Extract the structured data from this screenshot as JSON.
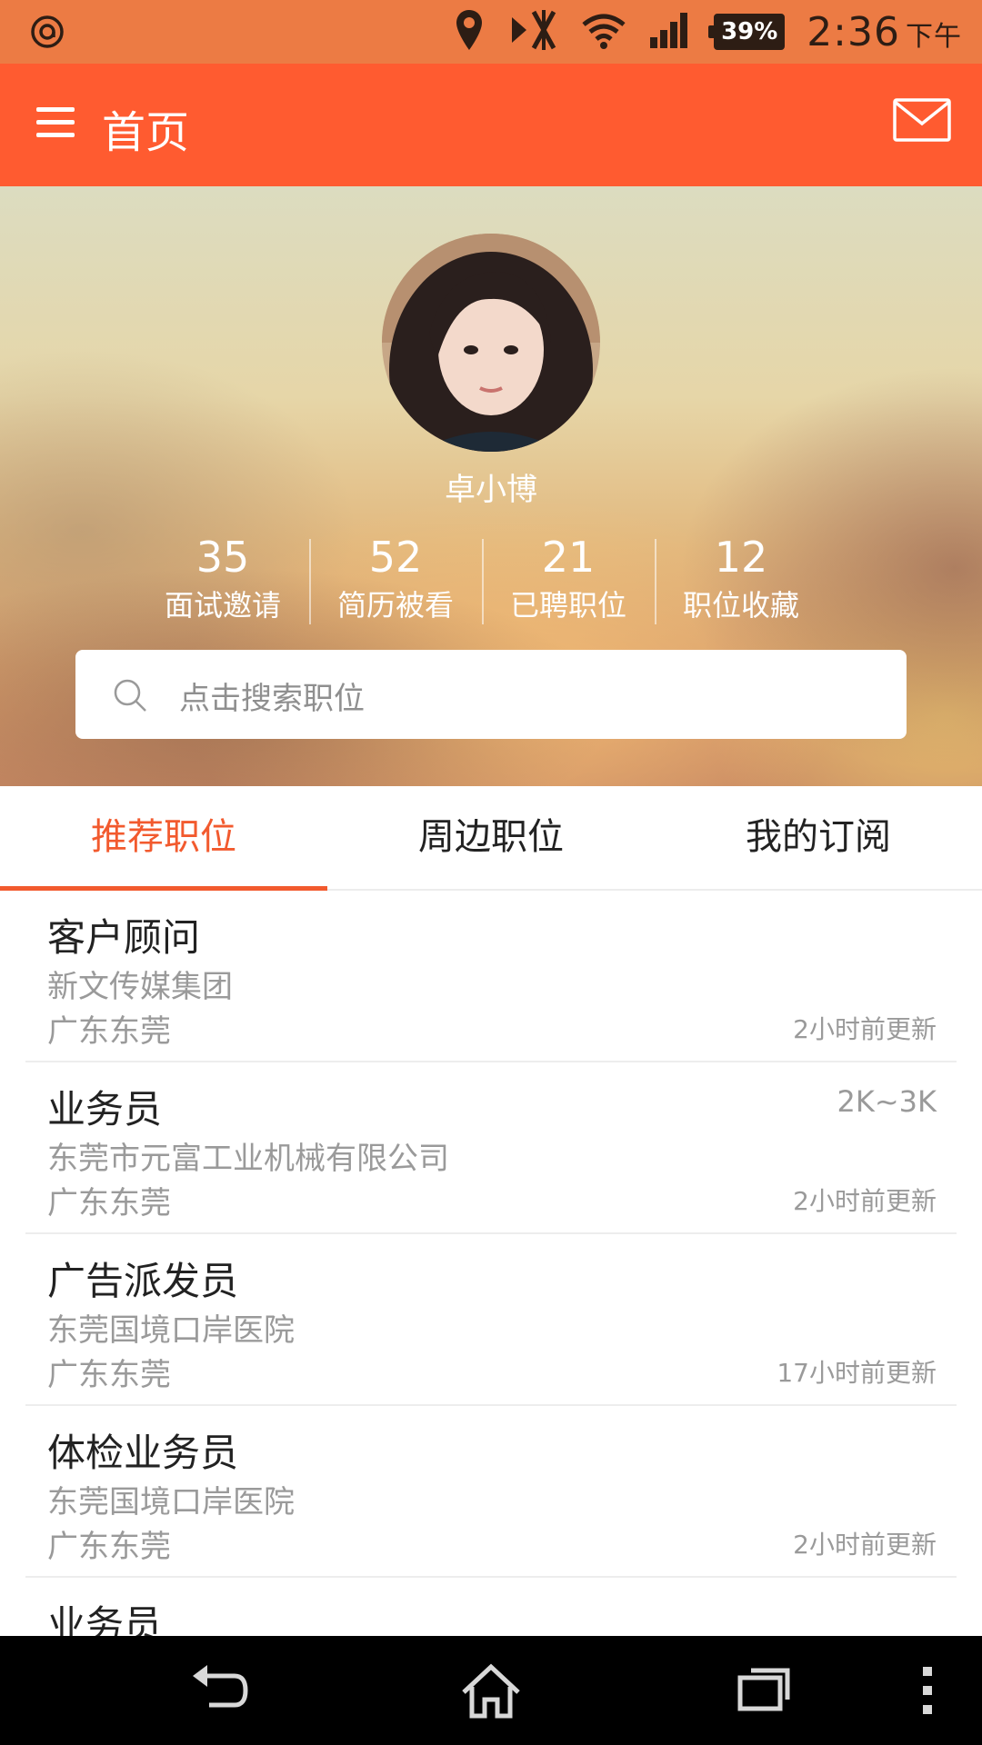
{
  "status_bar": {
    "battery": "39%",
    "time": "2:36",
    "ampm": "下午"
  },
  "app_bar": {
    "title": "首页"
  },
  "profile": {
    "name": "卓小博",
    "stats": [
      {
        "value": "35",
        "label": "面试邀请"
      },
      {
        "value": "52",
        "label": "简历被看"
      },
      {
        "value": "21",
        "label": "已聘职位"
      },
      {
        "value": "12",
        "label": "职位收藏"
      }
    ]
  },
  "search": {
    "placeholder": "点击搜索职位"
  },
  "tabs": [
    {
      "label": "推荐职位",
      "active": true
    },
    {
      "label": "周边职位",
      "active": false
    },
    {
      "label": "我的订阅",
      "active": false
    }
  ],
  "jobs": [
    {
      "title": "客户顾问",
      "company": "新文传媒集团",
      "location": "广东东莞",
      "salary": "",
      "updated": "2小时前更新"
    },
    {
      "title": "业务员",
      "company": "东莞市元富工业机械有限公司",
      "location": "广东东莞",
      "salary": "2K~3K",
      "updated": "2小时前更新"
    },
    {
      "title": "广告派发员",
      "company": "东莞国境口岸医院",
      "location": "广东东莞",
      "salary": "",
      "updated": "17小时前更新"
    },
    {
      "title": "体检业务员",
      "company": "东莞国境口岸医院",
      "location": "广东东莞",
      "salary": "",
      "updated": "2小时前更新"
    },
    {
      "title": "业务员",
      "company": "",
      "location": "",
      "salary": "",
      "updated": ""
    }
  ],
  "colors": {
    "app_bar": "#ff5b30",
    "status_bar": "#ec7b44",
    "accent": "#f25a2e"
  }
}
